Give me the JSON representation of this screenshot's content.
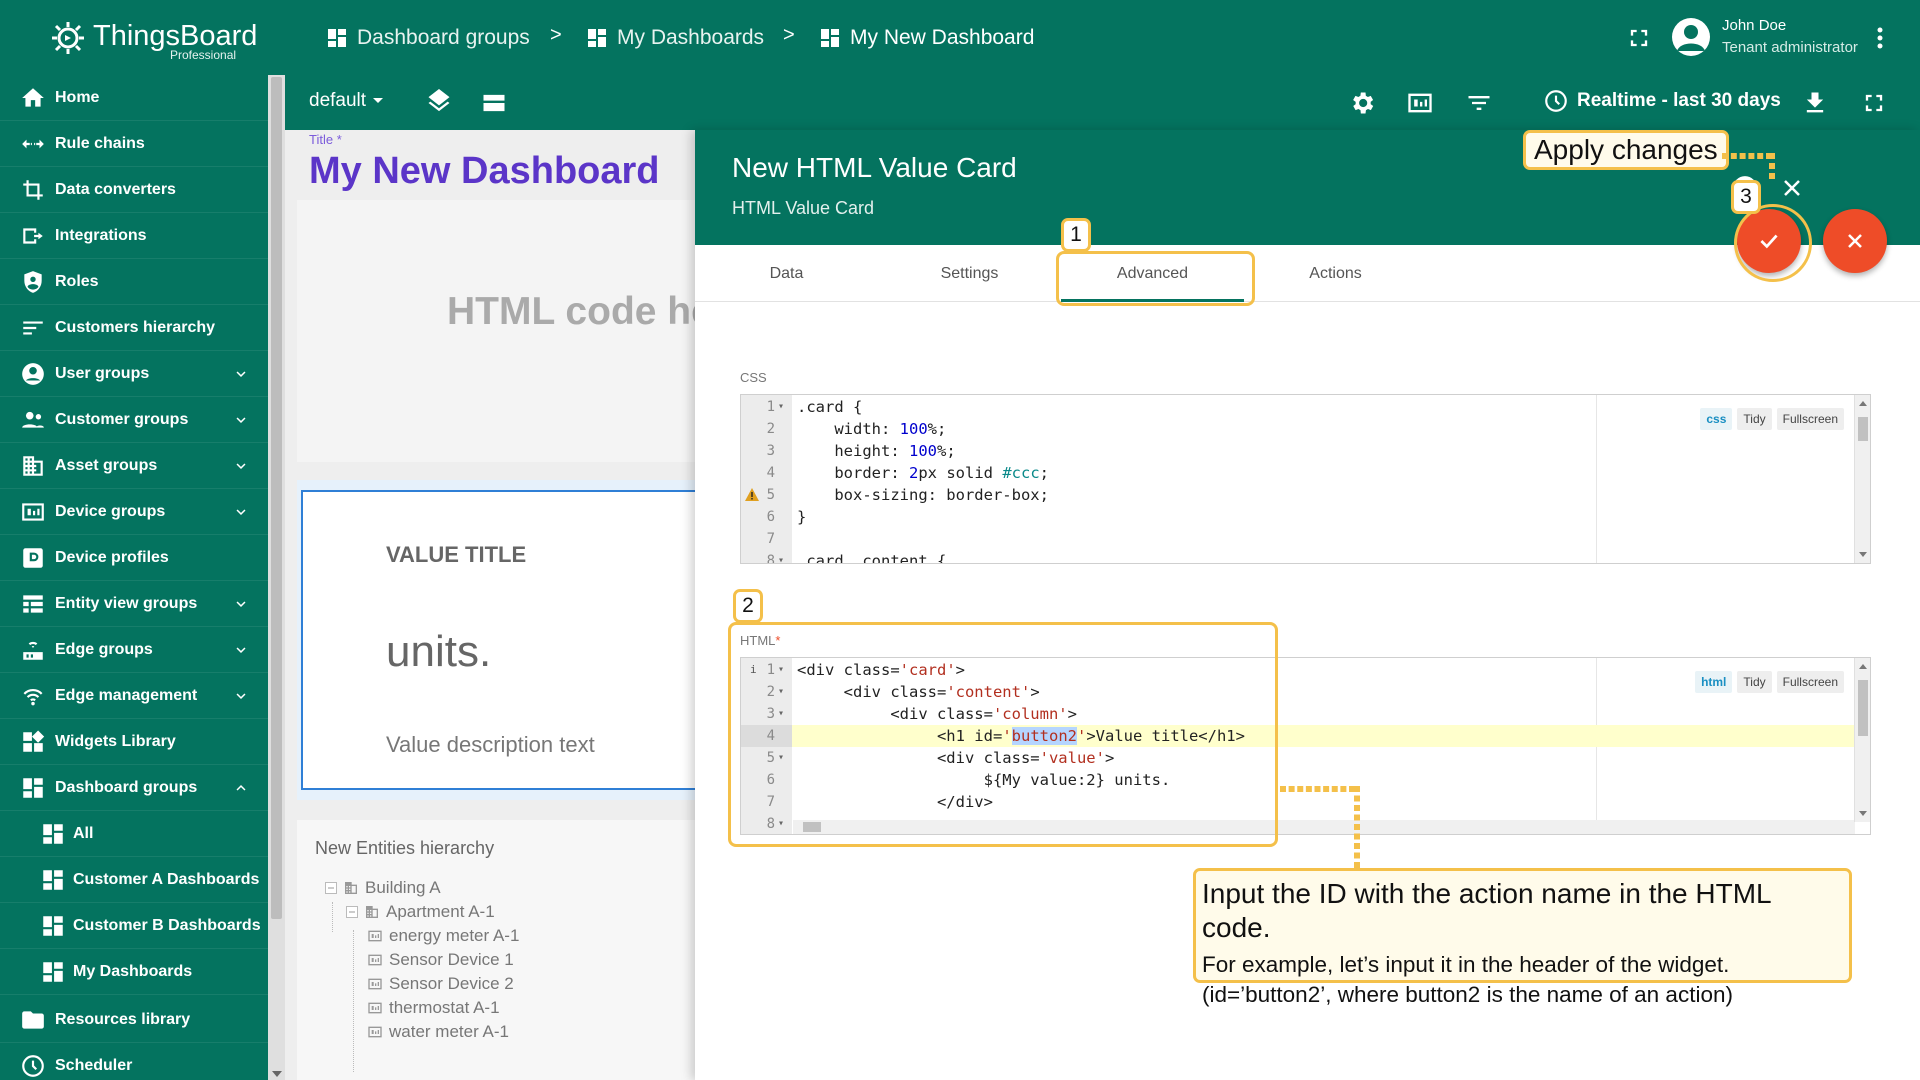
{
  "app": {
    "logo_name": "ThingsBoard",
    "logo_sub": "Professional"
  },
  "breadcrumbs": [
    {
      "label": "Dashboard groups",
      "icon": "dashboard-grid-icon"
    },
    {
      "label": "My Dashboards",
      "icon": "dashboard-grid-icon"
    },
    {
      "label": "My New Dashboard",
      "icon": "dashboard-grid-icon"
    }
  ],
  "breadcrumb_separator": ">",
  "user": {
    "name": "John Doe",
    "role": "Tenant administrator"
  },
  "sidebar": {
    "items": [
      {
        "label": "Home",
        "icon": "home-icon"
      },
      {
        "label": "Rule chains",
        "icon": "rule-chain-icon"
      },
      {
        "label": "Data converters",
        "icon": "converter-icon"
      },
      {
        "label": "Integrations",
        "icon": "integration-icon"
      },
      {
        "label": "Roles",
        "icon": "shield-icon"
      },
      {
        "label": "Customers hierarchy",
        "icon": "hierarchy-icon"
      },
      {
        "label": "User groups",
        "icon": "user-icon",
        "expandable": true
      },
      {
        "label": "Customer groups",
        "icon": "users-icon",
        "expandable": true
      },
      {
        "label": "Asset groups",
        "icon": "building-icon",
        "expandable": true
      },
      {
        "label": "Device groups",
        "icon": "device-icon",
        "expandable": true
      },
      {
        "label": "Device profiles",
        "icon": "device-profile-icon"
      },
      {
        "label": "Entity view groups",
        "icon": "entity-view-icon",
        "expandable": true
      },
      {
        "label": "Edge groups",
        "icon": "edge-icon",
        "expandable": true
      },
      {
        "label": "Edge management",
        "icon": "edge-management-icon",
        "expandable": true
      },
      {
        "label": "Widgets Library",
        "icon": "widgets-icon"
      },
      {
        "label": "Dashboard groups",
        "icon": "dashboard-grid-icon",
        "expanded": true
      },
      {
        "label": "All",
        "icon": "dashboard-grid-icon",
        "sub": true
      },
      {
        "label": "Customer A Dashboards",
        "icon": "dashboard-grid-icon",
        "sub": true
      },
      {
        "label": "Customer B Dashboards",
        "icon": "dashboard-grid-icon",
        "sub": true
      },
      {
        "label": "My Dashboards",
        "icon": "dashboard-grid-icon",
        "sub": true
      },
      {
        "label": "Resources library",
        "icon": "folder-icon"
      },
      {
        "label": "Scheduler",
        "icon": "clock-icon"
      }
    ]
  },
  "toolbar": {
    "state": "default",
    "timewindow": "Realtime - last 30 days"
  },
  "dashboard": {
    "title_label": "Title *",
    "title": "My New Dashboard",
    "html_card_text": "HTML code he",
    "value_card": {
      "title": "VALUE TITLE",
      "units": "units.",
      "description": "Value description text"
    },
    "hierarchy": {
      "title": "New Entities hierarchy",
      "nodes": [
        "Building A",
        "Apartment A-1",
        "energy meter A-1",
        "Sensor Device 1",
        "Sensor Device 2",
        "thermostat A-1",
        "water meter A-1"
      ]
    }
  },
  "panel": {
    "title": "New HTML Value Card",
    "subtitle": "HTML Value Card",
    "tabs": [
      "Data",
      "Settings",
      "Advanced",
      "Actions"
    ],
    "active_tab": "Advanced",
    "css_label": "CSS",
    "html_label": "HTML",
    "required_mark": "*",
    "editor_buttons": {
      "css_mode": "css",
      "html_mode": "html",
      "tidy": "Tidy",
      "fullscreen": "Fullscreen"
    },
    "css_lines": [
      {
        "n": "1",
        "fold": true,
        "text": ".card {"
      },
      {
        "n": "2",
        "text": "    width: 100%;"
      },
      {
        "n": "3",
        "text": "    height: 100%;"
      },
      {
        "n": "4",
        "text": "    border: 2px solid #ccc;"
      },
      {
        "n": "5",
        "warn": true,
        "text": "    box-sizing: border-box;"
      },
      {
        "n": "6",
        "text": "}"
      },
      {
        "n": "7",
        "text": ""
      },
      {
        "n": "8",
        "fold": true,
        "text": ".card .content {"
      }
    ],
    "html_lines": [
      {
        "n": "1",
        "fold": true,
        "info": true,
        "text": "<div class='card'>"
      },
      {
        "n": "2",
        "fold": true,
        "text": "     <div class='content'>"
      },
      {
        "n": "3",
        "fold": true,
        "text": "          <div class='column'>"
      },
      {
        "n": "4",
        "highlight": true,
        "text": "               <h1 id='button2'>Value title</h1>"
      },
      {
        "n": "5",
        "fold": true,
        "text": "               <div class='value'>"
      },
      {
        "n": "6",
        "text": "                    ${My value:2} units."
      },
      {
        "n": "7",
        "text": "               </div>"
      },
      {
        "n": "8",
        "fold": true,
        "text": ""
      }
    ]
  },
  "annotations": {
    "apply_changes": "Apply changes",
    "step1": "1",
    "step2": "2",
    "step3": "3",
    "callout_heading": "Input the ID with the action name in the HTML code.",
    "callout_line1": "For example, let’s input it in the header of the widget.",
    "callout_line2": "(id=’button2’, where button2 is the name of an action)"
  },
  "colors": {
    "primary": "#04735f",
    "accent": "#ee4c28",
    "annotation": "#f4c04a",
    "dashboard_title": "#5b35c8"
  }
}
